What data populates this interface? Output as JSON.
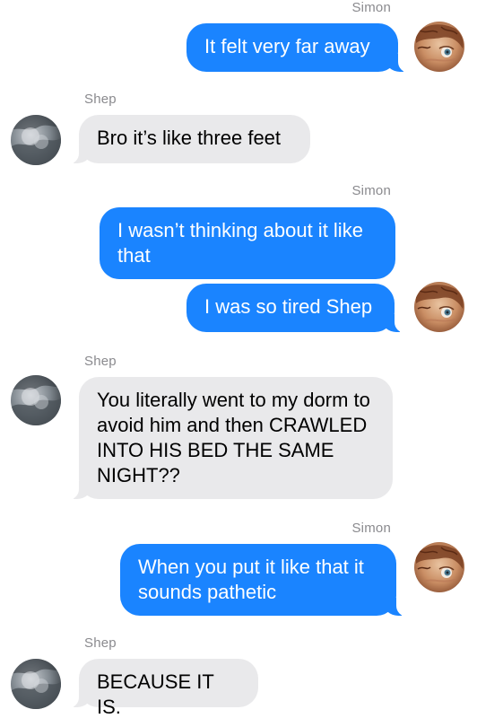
{
  "conversation": {
    "participants": {
      "simon": "Simon",
      "shep": "Shep"
    },
    "messages": [
      {
        "sender": "Simon",
        "direction": "outgoing",
        "text": "It felt very far away"
      },
      {
        "sender": "Shep",
        "direction": "incoming",
        "text": "Bro it’s like three feet"
      },
      {
        "sender": "Simon",
        "direction": "outgoing",
        "text": "I wasn’t thinking about it like that"
      },
      {
        "sender": "Simon",
        "direction": "outgoing",
        "text": "I was so tired Shep"
      },
      {
        "sender": "Shep",
        "direction": "incoming",
        "text": "You literally went to my dorm to avoid him and then CRAWLED INTO HIS BED THE SAME NIGHT??"
      },
      {
        "sender": "Simon",
        "direction": "outgoing",
        "text": "When you put it like that it sounds pathetic"
      },
      {
        "sender": "Shep",
        "direction": "incoming",
        "text": "BECAUSE IT IS."
      }
    ]
  },
  "colors": {
    "outgoing_bubble": "#1a84ff",
    "incoming_bubble": "#e9e9eb",
    "sender_name": "#8a8a8e"
  },
  "icons": {
    "simon_avatar": "simon-avatar-icon",
    "shep_avatar": "shep-avatar-icon"
  }
}
